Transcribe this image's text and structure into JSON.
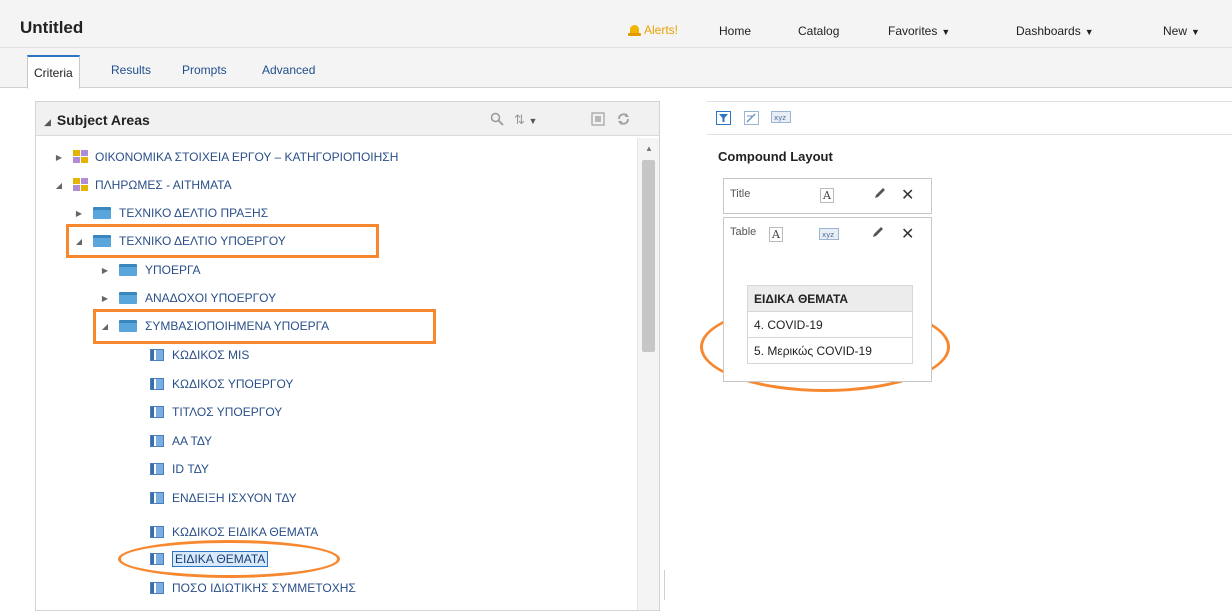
{
  "header": {
    "title": "Untitled",
    "alerts_label": "Alerts!",
    "nav": [
      {
        "label": "Home",
        "caret": false
      },
      {
        "label": "Catalog",
        "caret": false
      },
      {
        "label": "Favorites",
        "caret": true
      },
      {
        "label": "Dashboards",
        "caret": true
      },
      {
        "label": "New",
        "caret": true
      }
    ]
  },
  "tabs": [
    "Criteria",
    "Results",
    "Prompts",
    "Advanced"
  ],
  "subject_areas": {
    "title": "Subject Areas",
    "toolbar_icons": [
      "search-icon",
      "sort-icon",
      "view-options-icon",
      "refresh-icon"
    ],
    "tree": [
      {
        "label": "ΟΙΚΟΝΟΜΙΚΑ ΣΤΟΙΧΕΙΑ ΕΡΓΟΥ – ΚΑΤΗΓΟΡΙΟΠΟΙΗΣΗ",
        "type": "area",
        "state": "collapsed"
      },
      {
        "label": "ΠΛΗΡΩΜΕΣ - ΑΙΤΗΜΑΤΑ",
        "type": "area",
        "state": "expanded"
      },
      {
        "label": "ΤΕΧΝΙΚΟ ΔΕΛΤΙΟ ΠΡΑΞΗΣ",
        "type": "folder",
        "state": "collapsed"
      },
      {
        "label": "ΤΕΧΝΙΚΟ ΔΕΛΤΙΟ ΥΠΟΕΡΓΟΥ",
        "type": "folder",
        "state": "expanded"
      },
      {
        "label": "ΥΠΟΕΡΓΑ",
        "type": "folder",
        "state": "collapsed"
      },
      {
        "label": "ΑΝΑΔΟΧΟΙ ΥΠΟΕΡΓΟΥ",
        "type": "folder",
        "state": "collapsed"
      },
      {
        "label": "ΣΥΜΒΑΣΙΟΠΟΙΗΜΕΝΑ ΥΠΟΕΡΓΑ",
        "type": "folder",
        "state": "expanded"
      },
      {
        "label": "ΚΩΔΙΚΟΣ MIS",
        "type": "column"
      },
      {
        "label": "ΚΩΔΙΚΟΣ ΥΠΟΕΡΓΟΥ",
        "type": "column"
      },
      {
        "label": "ΤΙΤΛΟΣ ΥΠΟΕΡΓΟΥ",
        "type": "column"
      },
      {
        "label": "ΑΑ ΤΔΥ",
        "type": "column"
      },
      {
        "label": "ID ΤΔΥ",
        "type": "column"
      },
      {
        "label": "ΕΝΔΕΙΞΗ ΙΣΧΥΟΝ ΤΔΥ",
        "type": "column"
      },
      {
        "label": "ΚΩΔΙΚΟΣ ΕΙΔΙΚΑ ΘΕΜΑΤΑ",
        "type": "column"
      },
      {
        "label": "ΕΙΔΙΚΑ ΘΕΜΑΤΑ",
        "type": "column",
        "selected": true
      },
      {
        "label": "ΠΟΣΟ ΙΔΙΩΤΙΚΗΣ ΣΥΜΜΕΤΟΧΗΣ",
        "type": "column"
      }
    ]
  },
  "layout": {
    "toolbar_icons": [
      "filter-icon",
      "edit-view-icon",
      "text-view-icon"
    ],
    "compound_title": "Compound Layout",
    "title_view": {
      "label": "Title"
    },
    "table_view": {
      "label": "Table",
      "header": "ΕΙΔΙΚΑ ΘΕΜΑΤΑ",
      "rows": [
        "4. COVID-19",
        "5. Μερικώς COVID-19"
      ]
    }
  },
  "colors": {
    "highlight": "#f7882f",
    "link": "#2a4f88",
    "alert": "#e7a200",
    "tab_accent": "#2c75c4"
  }
}
